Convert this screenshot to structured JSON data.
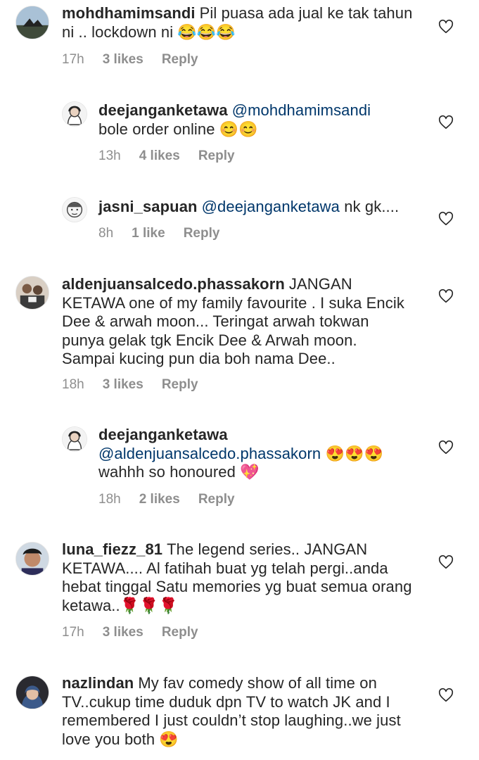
{
  "comments": [
    {
      "username": "mohdhamimsandi",
      "mention": "",
      "text": "Pil puasa ada jual ke tak tahun ni .. lockdown ni 😂😂😂",
      "time": "17h",
      "likes": "3 likes",
      "reply": "Reply",
      "avatar_icon": "landscape-avatar"
    },
    {
      "username": "deejanganketawa",
      "mention": "@mohdhamimsandi",
      "text": "bole order online 😊😊",
      "time": "13h",
      "likes": "4 likes",
      "reply": "Reply",
      "avatar_icon": "hijab-avatar"
    },
    {
      "username": "jasni_sapuan",
      "mention": "@deejanganketawa",
      "text": "nk gk....",
      "time": "8h",
      "likes": "1 like",
      "reply": "Reply",
      "avatar_icon": "sketch-face-avatar"
    },
    {
      "username": "aldenjuansalcedo.phassakorn",
      "mention": "",
      "text": "JANGAN KETAWA one of my family favourite .  I suka Encik Dee & arwah moon... Teringat arwah tokwan punya gelak tgk Encik Dee & Arwah moon.  Sampai kucing pun dia boh nama Dee..",
      "time": "18h",
      "likes": "3 likes",
      "reply": "Reply",
      "avatar_icon": "group-photo-avatar"
    },
    {
      "username": "deejanganketawa",
      "mention": "@aldenjuansalcedo.phassakorn",
      "text": "😍😍😍 wahhh so honoured 💖",
      "time": "18h",
      "likes": "2 likes",
      "reply": "Reply",
      "avatar_icon": "hijab-avatar"
    },
    {
      "username": "luna_fiezz_81",
      "mention": "",
      "text": "The legend series.. JANGAN KETAWA.... Al fatihah buat yg telah pergi..anda hebat tinggal Satu memories yg buat semua orang ketawa..🌹🌹🌹",
      "time": "17h",
      "likes": "3 likes",
      "reply": "Reply",
      "avatar_icon": "face-avatar"
    },
    {
      "username": "nazlindan",
      "mention": "",
      "text": "My fav comedy show of all time on TV..cukup time duduk dpn TV to watch JK and I remembered I just couldn’t stop laughing..we just love you both 😍",
      "time": "",
      "likes": "",
      "reply": "",
      "avatar_icon": "hijab-selfie-avatar"
    }
  ]
}
